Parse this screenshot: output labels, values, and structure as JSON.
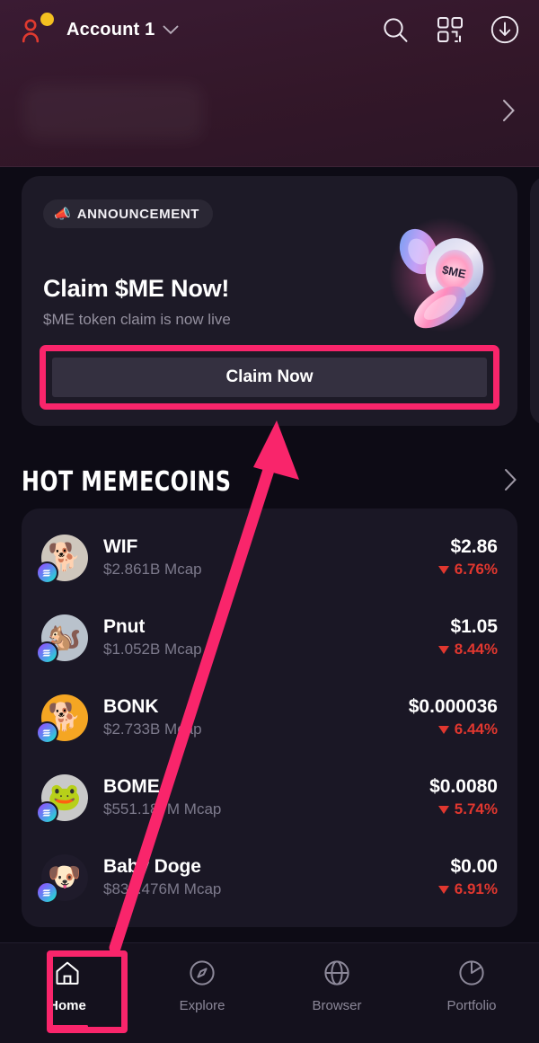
{
  "header": {
    "account_name": "Account 1",
    "avatar_icon": "person-icon",
    "chevron_icon": "chevron-down-icon",
    "actions": [
      {
        "name": "search-icon",
        "label": "Search"
      },
      {
        "name": "qr-scan-icon",
        "label": "Scan"
      },
      {
        "name": "receive-download-icon",
        "label": "Receive"
      }
    ]
  },
  "balance": {
    "hidden": true,
    "chevron_icon": "chevron-right-icon"
  },
  "announcement": {
    "badge_emoji": "📣",
    "badge_label": "ANNOUNCEMENT",
    "title": "Claim $ME Now!",
    "subtitle": "$ME token claim is now live",
    "cta_label": "Claim Now",
    "coin_label": "$ME",
    "highlight_color": "#f9256b"
  },
  "hot_memecoins": {
    "title": "HOT MEMECOINS",
    "chevron_icon": "chevron-right-icon",
    "coins": [
      {
        "symbol": "WIF",
        "mcap": "$2.861B Mcap",
        "price": "$2.86",
        "change": "6.76%",
        "direction": "down",
        "chain": "solana"
      },
      {
        "symbol": "Pnut",
        "mcap": "$1.052B Mcap",
        "price": "$1.05",
        "change": "8.44%",
        "direction": "down",
        "chain": "solana"
      },
      {
        "symbol": "BONK",
        "mcap": "$2.733B Mcap",
        "price": "$0.000036",
        "change": "6.44%",
        "direction": "down",
        "chain": "solana"
      },
      {
        "symbol": "BOME",
        "mcap": "$551.187M Mcap",
        "price": "$0.0080",
        "change": "5.74%",
        "direction": "down",
        "chain": "solana"
      },
      {
        "symbol": "Baby Doge",
        "mcap": "$830.476M Mcap",
        "price": "$0.00",
        "change": "6.91%",
        "direction": "down",
        "chain": "solana"
      }
    ],
    "change_color": "#e1372f"
  },
  "bottom_nav": {
    "items": [
      {
        "label": "Home",
        "icon": "home-icon",
        "active": true
      },
      {
        "label": "Explore",
        "icon": "compass-icon",
        "active": false
      },
      {
        "label": "Browser",
        "icon": "globe-icon",
        "active": false
      },
      {
        "label": "Portfolio",
        "icon": "pie-chart-icon",
        "active": false
      }
    ]
  },
  "annotation": {
    "arrow_color": "#f9256b",
    "from": "Home",
    "to": "Claim Now"
  }
}
